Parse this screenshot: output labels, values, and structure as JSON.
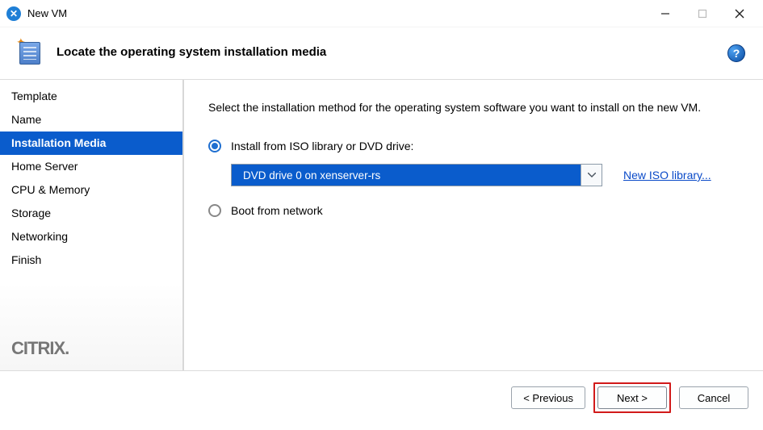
{
  "window": {
    "title": "New VM"
  },
  "header": {
    "title": "Locate the operating system installation media"
  },
  "sidebar": {
    "steps": [
      {
        "label": "Template"
      },
      {
        "label": "Name"
      },
      {
        "label": "Installation Media"
      },
      {
        "label": "Home Server"
      },
      {
        "label": "CPU & Memory"
      },
      {
        "label": "Storage"
      },
      {
        "label": "Networking"
      },
      {
        "label": "Finish"
      }
    ],
    "selected_index": 2,
    "brand": "CITRIX"
  },
  "content": {
    "instruction": "Select the installation method for the operating system software you want to install on the new VM.",
    "option_iso_label": "Install from ISO library or DVD drive:",
    "option_network_label": "Boot from network",
    "selected_option": "iso",
    "dropdown_value": "DVD drive 0 on xenserver-rs",
    "new_iso_link": "New ISO library..."
  },
  "footer": {
    "previous": "< Previous",
    "next": "Next >",
    "cancel": "Cancel"
  }
}
